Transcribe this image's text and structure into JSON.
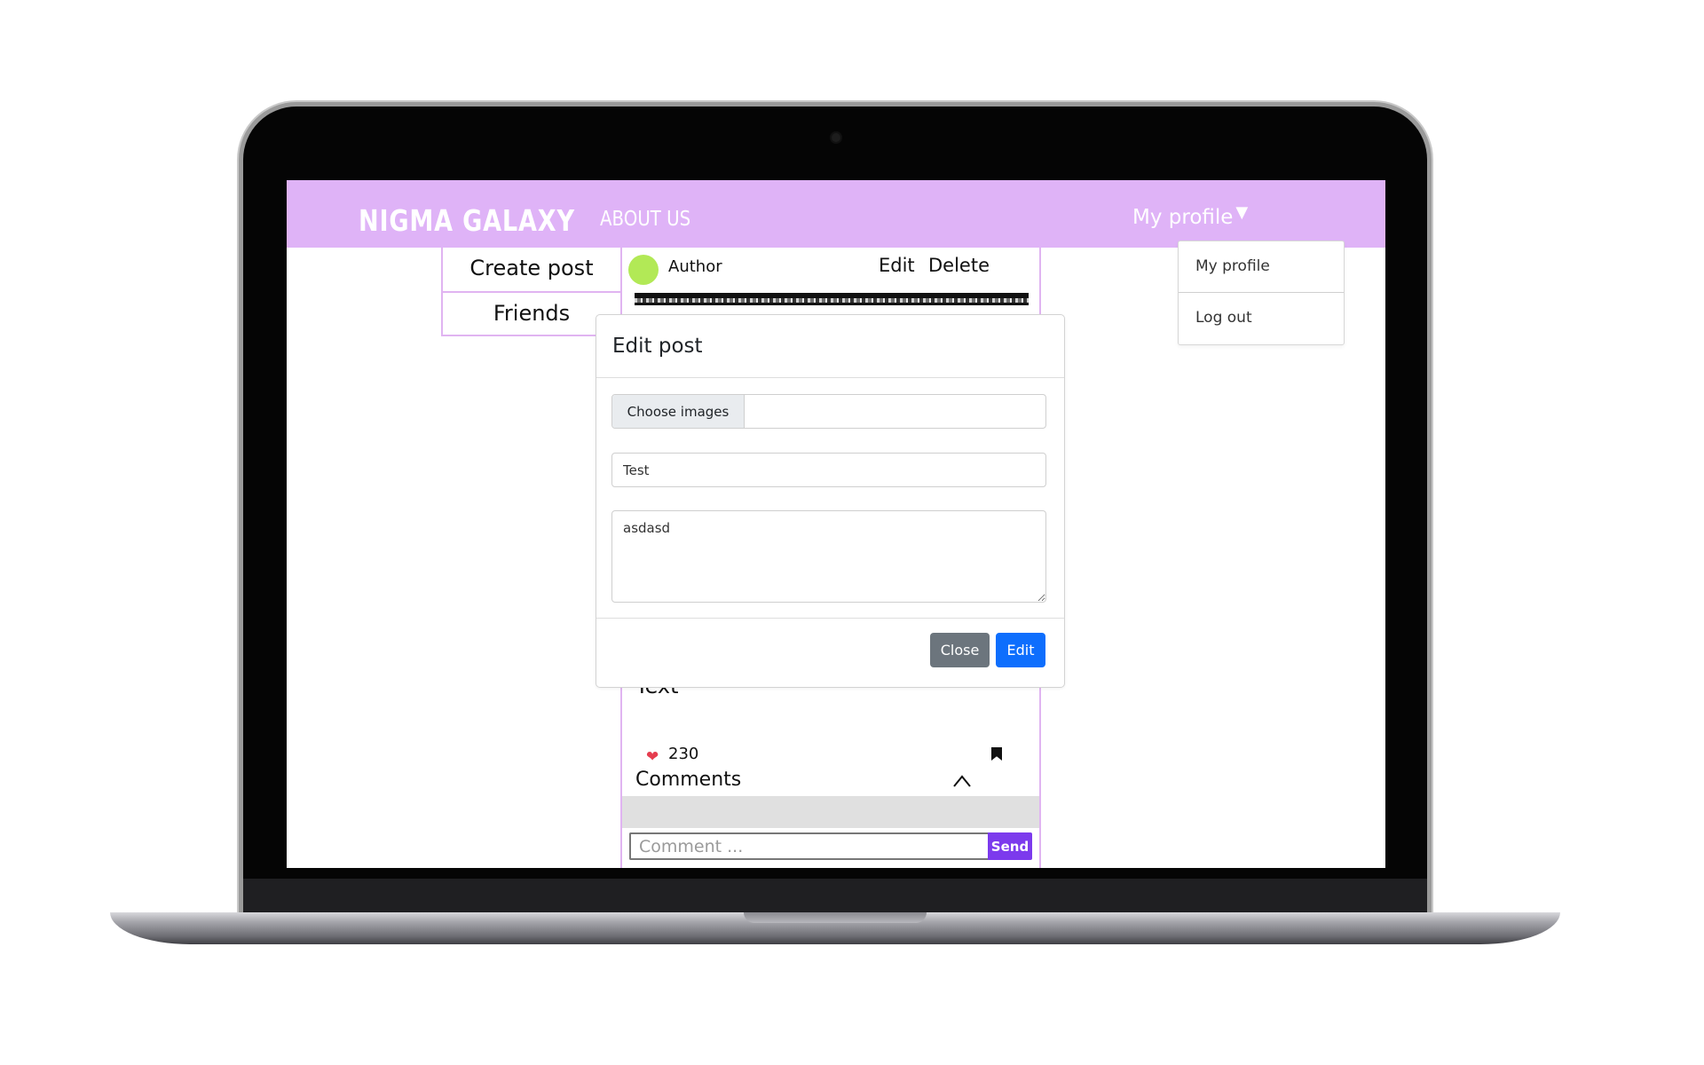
{
  "navbar": {
    "brand": "NIGMA GALAXY",
    "about_link": "ABOUT US",
    "profile_toggle": "My profile",
    "caret_icon": "caret-down-icon",
    "background_color": "#dfb3f7"
  },
  "profile_dropdown": {
    "items": [
      {
        "label": "My profile"
      },
      {
        "label": "Log out"
      }
    ]
  },
  "side_menu": {
    "items": [
      {
        "label": "Create post"
      },
      {
        "label": "Friends"
      }
    ]
  },
  "post": {
    "author": "Author",
    "edit_label": "Edit",
    "delete_label": "Delete",
    "text": "Text",
    "likes": "230",
    "comments_title": "Comments",
    "comment_placeholder": "Comment ...",
    "send_label": "Send",
    "avatar_color": "#b2e956",
    "send_color": "#7c3aed"
  },
  "edit_modal": {
    "title": "Edit post",
    "file_button_label": "Choose images",
    "title_value": "Test",
    "body_value": "asdasd",
    "close_label": "Close",
    "edit_label": "Edit",
    "close_color": "#6c757d",
    "edit_color": "#0d6efd"
  }
}
